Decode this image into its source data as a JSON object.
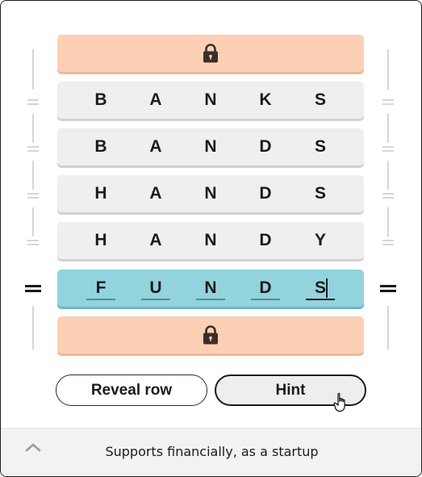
{
  "board": {
    "rows": [
      {
        "state": "locked",
        "letters": []
      },
      {
        "state": "word",
        "letters": [
          "B",
          "A",
          "N",
          "K",
          "S"
        ]
      },
      {
        "state": "word",
        "letters": [
          "B",
          "A",
          "N",
          "D",
          "S"
        ]
      },
      {
        "state": "word",
        "letters": [
          "H",
          "A",
          "N",
          "D",
          "S"
        ]
      },
      {
        "state": "word",
        "letters": [
          "H",
          "A",
          "N",
          "D",
          "Y"
        ]
      },
      {
        "state": "active",
        "letters": [
          "F",
          "U",
          "N",
          "D",
          "S"
        ]
      },
      {
        "state": "locked",
        "letters": []
      }
    ]
  },
  "icons": {
    "lock": "lock-icon",
    "expand": "chevron-up-icon",
    "cursor": "hand-pointer-icon"
  },
  "buttons": {
    "reveal_label": "Reveal row",
    "hint_label": "Hint"
  },
  "clue": {
    "text": "Supports financially, as a startup"
  },
  "colors": {
    "locked_row": "#fdd0b6",
    "word_row": "#efefef",
    "active_row": "#93d3de"
  }
}
